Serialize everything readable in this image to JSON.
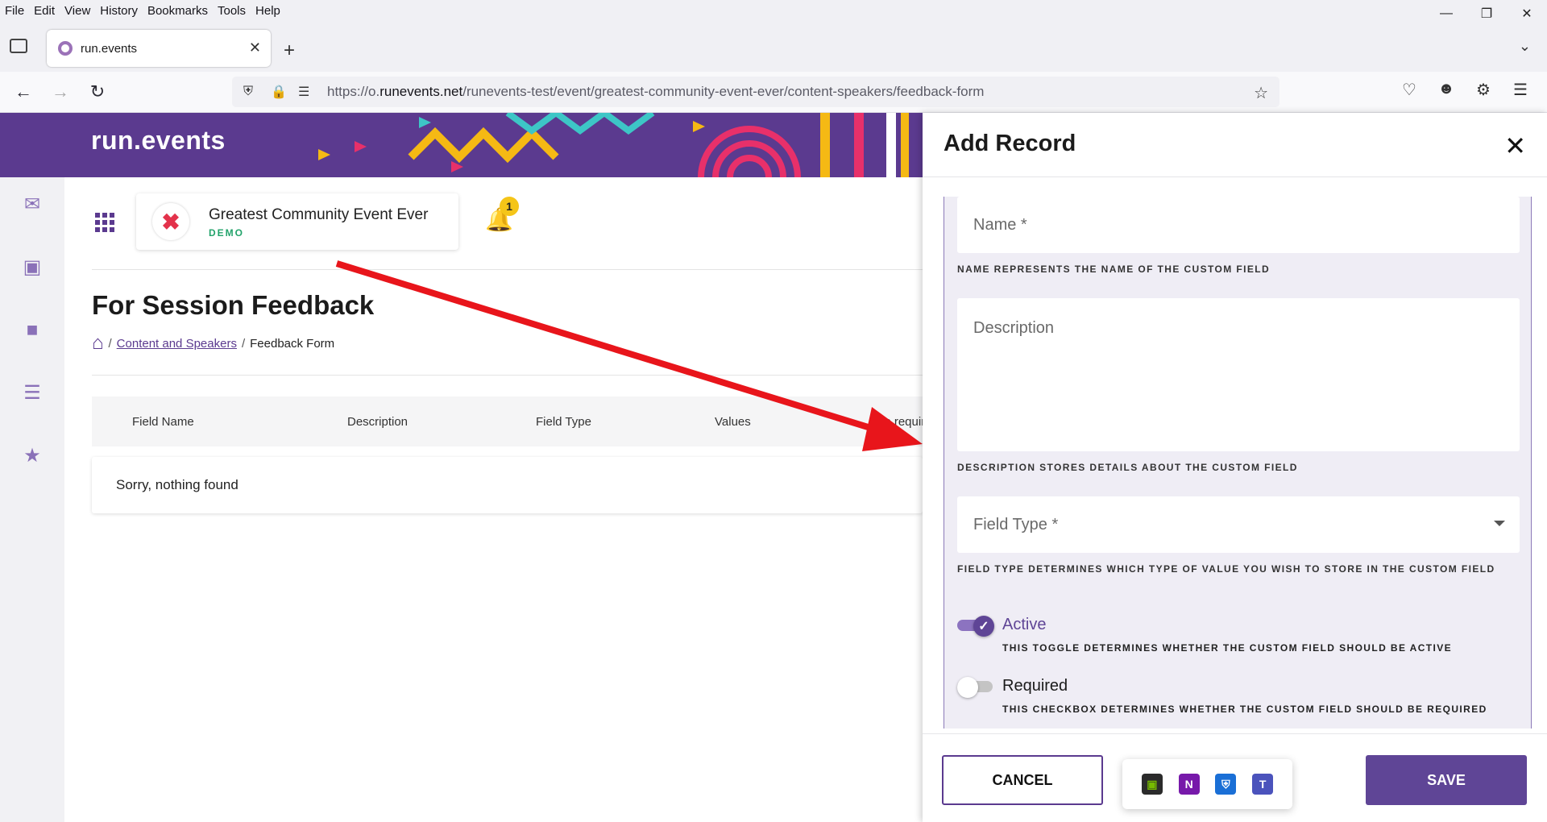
{
  "browser": {
    "menu": [
      "File",
      "Edit",
      "View",
      "History",
      "Bookmarks",
      "Tools",
      "Help"
    ],
    "tab_title": "run.events",
    "url_prefix": "https://o.",
    "url_domain": "runevents.net",
    "url_path": "/runevents-test/event/greatest-community-event-ever/content-speakers/feedback-form"
  },
  "app": {
    "logo": "run.events",
    "event_name": "Greatest Community Event Ever",
    "event_tag": "DEMO",
    "notification_count": "1",
    "page_title": "For Session Feedback",
    "breadcrumb": {
      "parent": "Content and Speakers",
      "current": "Feedback Form"
    },
    "table": {
      "columns": [
        "Field Name",
        "Description",
        "Field Type",
        "Values",
        "Is required"
      ],
      "empty_message": "Sorry, nothing found"
    }
  },
  "drawer": {
    "title": "Add Record",
    "name_placeholder": "Name *",
    "name_hint": "NAME REPRESENTS THE NAME OF THE CUSTOM FIELD",
    "description_placeholder": "Description",
    "description_hint": "DESCRIPTION STORES DETAILS ABOUT THE CUSTOM FIELD",
    "field_type_placeholder": "Field Type *",
    "field_type_hint": "FIELD TYPE DETERMINES WHICH TYPE OF VALUE YOU WISH TO STORE IN THE CUSTOM FIELD",
    "active_label": "Active",
    "active_hint": "THIS TOGGLE DETERMINES WHETHER THE CUSTOM FIELD SHOULD BE ACTIVE",
    "active_on": true,
    "required_label": "Required",
    "required_hint": "THIS CHECKBOX DETERMINES WHETHER THE CUSTOM FIELD SHOULD BE REQUIRED",
    "required_on": false,
    "cancel_label": "CANCEL",
    "save_label": "SAVE"
  },
  "colors": {
    "brand": "#5b3a8f",
    "accent_green": "#23a36b",
    "annotation_arrow": "#e8151b"
  }
}
